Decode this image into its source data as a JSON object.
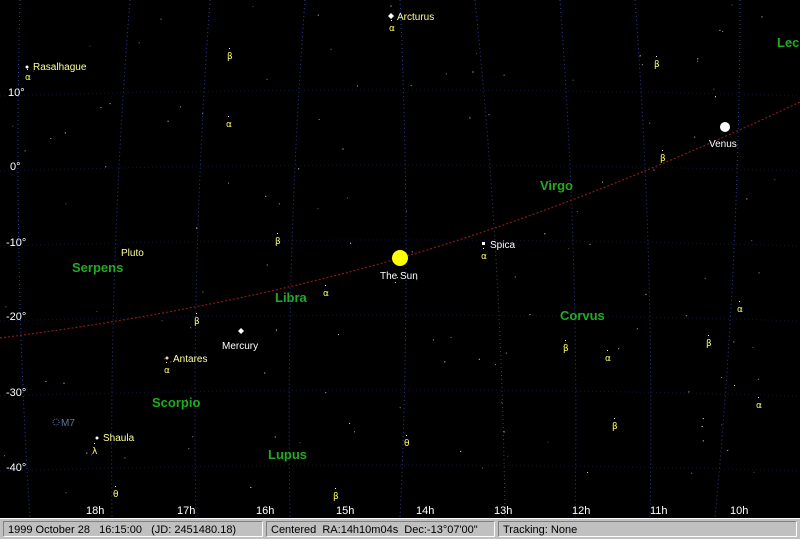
{
  "sky": {
    "colors": {
      "background": "#000000",
      "grid": "#2a3f8f",
      "ecliptic": "#8a1a1a",
      "star": "#ffffff",
      "greek": "#ffff66",
      "constellation": "#22aa22",
      "planet_label": "#ffffff",
      "sun": "#ffff00",
      "deep_sky": "#5a7a9a"
    },
    "dec_labels": [
      "10°",
      "0°",
      "-10°",
      "-20°",
      "-30°",
      "-40°"
    ],
    "ra_labels": [
      "18h",
      "17h",
      "16h",
      "15h",
      "14h",
      "13h",
      "12h",
      "11h",
      "10h"
    ],
    "constellations": [
      "Lec",
      "Virgo",
      "Serpens",
      "Libra",
      "Corvus",
      "Scorpio",
      "Lupus"
    ],
    "named_stars": [
      "Arcturus",
      "Rasalhague",
      "Spica",
      "Antares",
      "Shaula"
    ],
    "planets": [
      "Venus",
      "The Sun",
      "Mercury",
      "Pluto"
    ],
    "deep_sky": [
      "M7"
    ],
    "greek": [
      "α",
      "β",
      "θ",
      "λ"
    ]
  },
  "status": {
    "datetime": "1999 October 28   16:15:00   (JD: 2451480.18)",
    "centered": "Centered  RA:14h10m04s  Dec:-13°07'00\"",
    "tracking": "Tracking: None"
  }
}
